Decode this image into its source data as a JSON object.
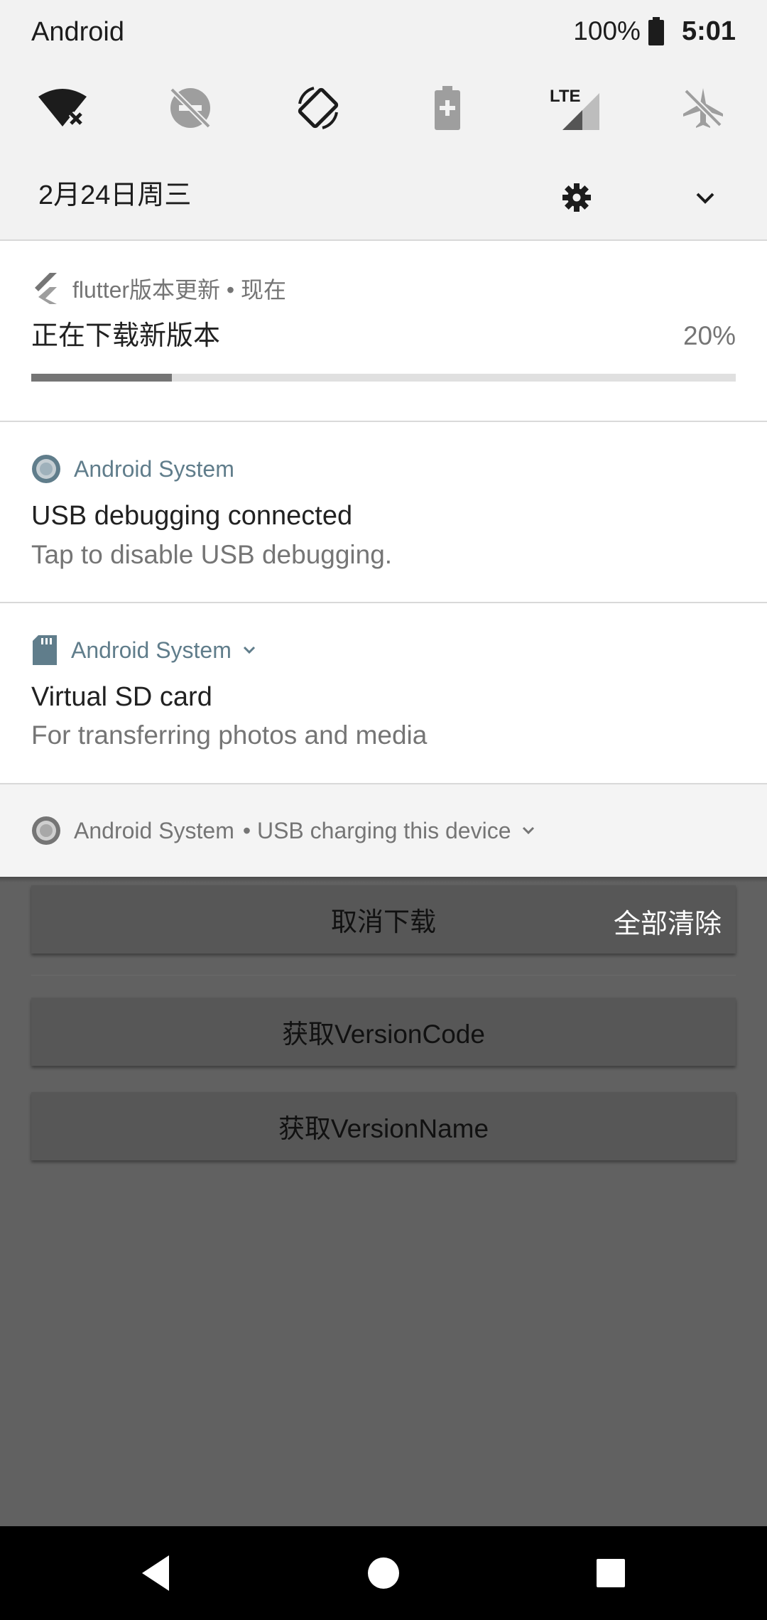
{
  "status_bar": {
    "carrier": "Android",
    "battery_percent": "100%",
    "time": "5:01"
  },
  "quick_settings": {
    "tiles": [
      "wifi-off-icon",
      "do-not-disturb-off-icon",
      "auto-rotate-icon",
      "battery-saver-icon",
      "lte-signal-icon",
      "airplane-mode-icon"
    ],
    "date": "2月24日周三"
  },
  "notifications": [
    {
      "app": "flutter版本更新 • 现在",
      "title": "正在下载新版本",
      "percent": "20%",
      "progress": 0.2
    },
    {
      "app": "Android System",
      "title": "USB debugging connected",
      "text": "Tap to disable USB debugging."
    },
    {
      "app": "Android System",
      "title": "Virtual SD card",
      "text": "For transferring photos and media"
    },
    {
      "app": "Android System",
      "summary": "• USB charging this device"
    }
  ],
  "clear_all_label": "全部清除",
  "app": {
    "buttons": [
      "取消下载",
      "获取VersionCode",
      "获取VersionName"
    ]
  },
  "colors": {
    "accent": "#607d8b",
    "scrim": "#616161"
  }
}
